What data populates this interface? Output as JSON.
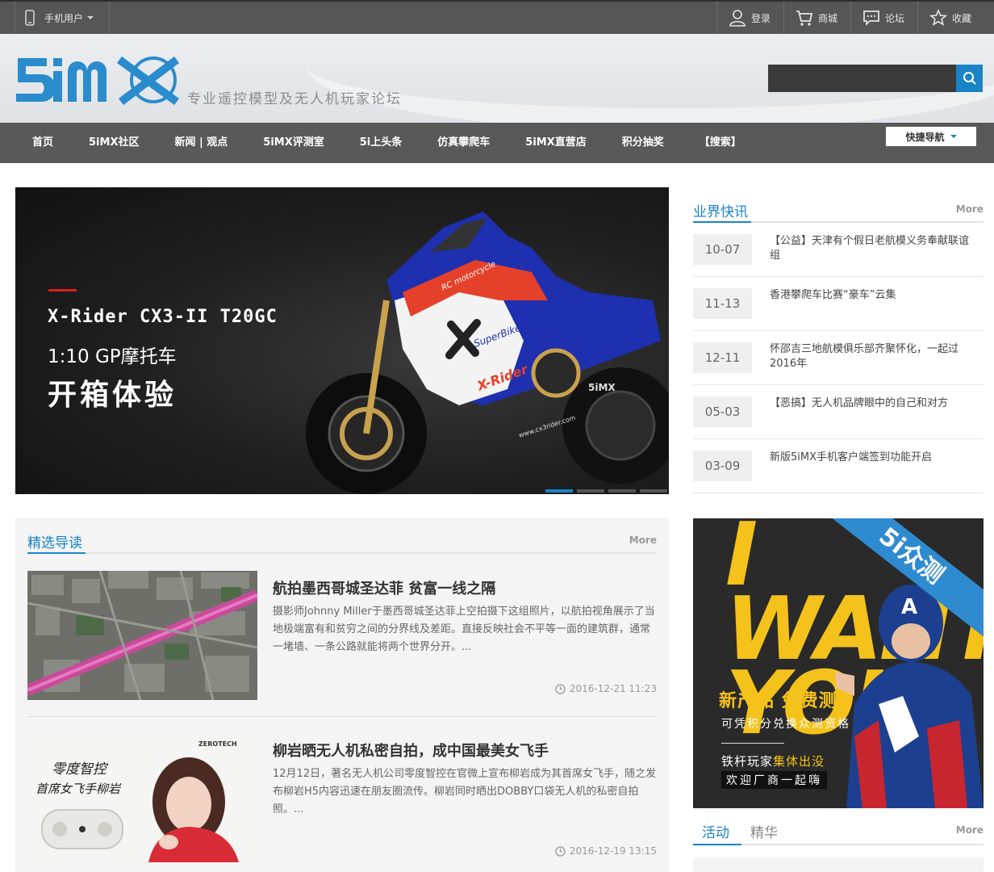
{
  "topbar": {
    "mobile_label": "手机用户",
    "links": [
      {
        "icon": "user-icon",
        "label": "登录"
      },
      {
        "icon": "cart-icon",
        "label": "商城"
      },
      {
        "icon": "chat-icon",
        "label": "论坛"
      },
      {
        "icon": "star-icon",
        "label": "收藏"
      }
    ]
  },
  "header": {
    "logo_text": "5iMX",
    "tagline": "专业遥控模型及无人机玩家论坛",
    "search_placeholder": ""
  },
  "nav": {
    "items": [
      "首页",
      "5iMX社区",
      "新闻 | 观点",
      "5iMX评测室",
      "5i上头条",
      "仿真攀爬车",
      "5iMX直营店",
      "积分抽奖",
      "【搜索】"
    ],
    "quick_nav_label": "快捷导航"
  },
  "hero": {
    "line1": "X-Rider CX3-II T20GC",
    "line2": "1:10 GP摩托车",
    "line3": "开箱体验",
    "slides": 4,
    "active_slide": 1,
    "bike_texts": [
      "RC motorcycle",
      "SuperBike",
      "X-Rider",
      "www.cx3rider.com",
      "5iMX"
    ]
  },
  "news": {
    "title": "业界快讯",
    "more": "More",
    "items": [
      {
        "date": "10-07",
        "text": "【公益】天津有个假日老航模义务奉献联谊组"
      },
      {
        "date": "11-13",
        "text": "香港攀爬车比赛“豪车”云集"
      },
      {
        "date": "12-11",
        "text": "怀邵吉三地航模俱乐部齐聚怀化，一起过2016年"
      },
      {
        "date": "05-03",
        "text": "【恶搞】无人机品牌眼中的自己和对方"
      },
      {
        "date": "03-09",
        "text": "新版5iMX手机客户端签到功能开启"
      }
    ]
  },
  "featured": {
    "title": "精选导读",
    "more": "More",
    "articles": [
      {
        "title": "航拍墨西哥城圣达菲 贫富一线之隔",
        "desc": "摄影师Johnny Miller于墨西哥城圣达菲上空拍摄下这组照片，以航拍视角展示了当地极端富有和贫穷之间的分界线及差距。直接反映社会不平等一面的建筑群，通常一堵墙、一条公路就能将两个世界分开。...",
        "time": "2016-12-21 11:23"
      },
      {
        "title": "柳岩晒无人机私密自拍，成中国最美女飞手",
        "desc": "12月12日，著名无人机公司零度智控在官微上宣布柳岩成为其首席女飞手，随之发布柳岩H5内容迅速在朋友圈流传。柳岩同时晒出DOBBY口袋无人机的私密自拍照。...",
        "time": "2016-12-19 13:15",
        "thumb_texts": [
          "ZEROTECH",
          "零度智控",
          "首席女飞手柳岩"
        ]
      }
    ]
  },
  "ad": {
    "big_text": "I WANT YOU",
    "stripe": "5i众测",
    "line1": "新产品 免费测",
    "line2": "可凭积分兑换众测资格",
    "line3_a": "铁杆玩家",
    "line3_b": "集体出没",
    "line4": "欢迎厂商一起嗨"
  },
  "activity": {
    "tabs": [
      "活动",
      "精华"
    ],
    "more": "More"
  },
  "colors": {
    "accent": "#1a83c6",
    "topbar": "#565656",
    "nav": "#595959",
    "ad_yellow": "#f4c21a",
    "hero_red": "#d7221f"
  }
}
